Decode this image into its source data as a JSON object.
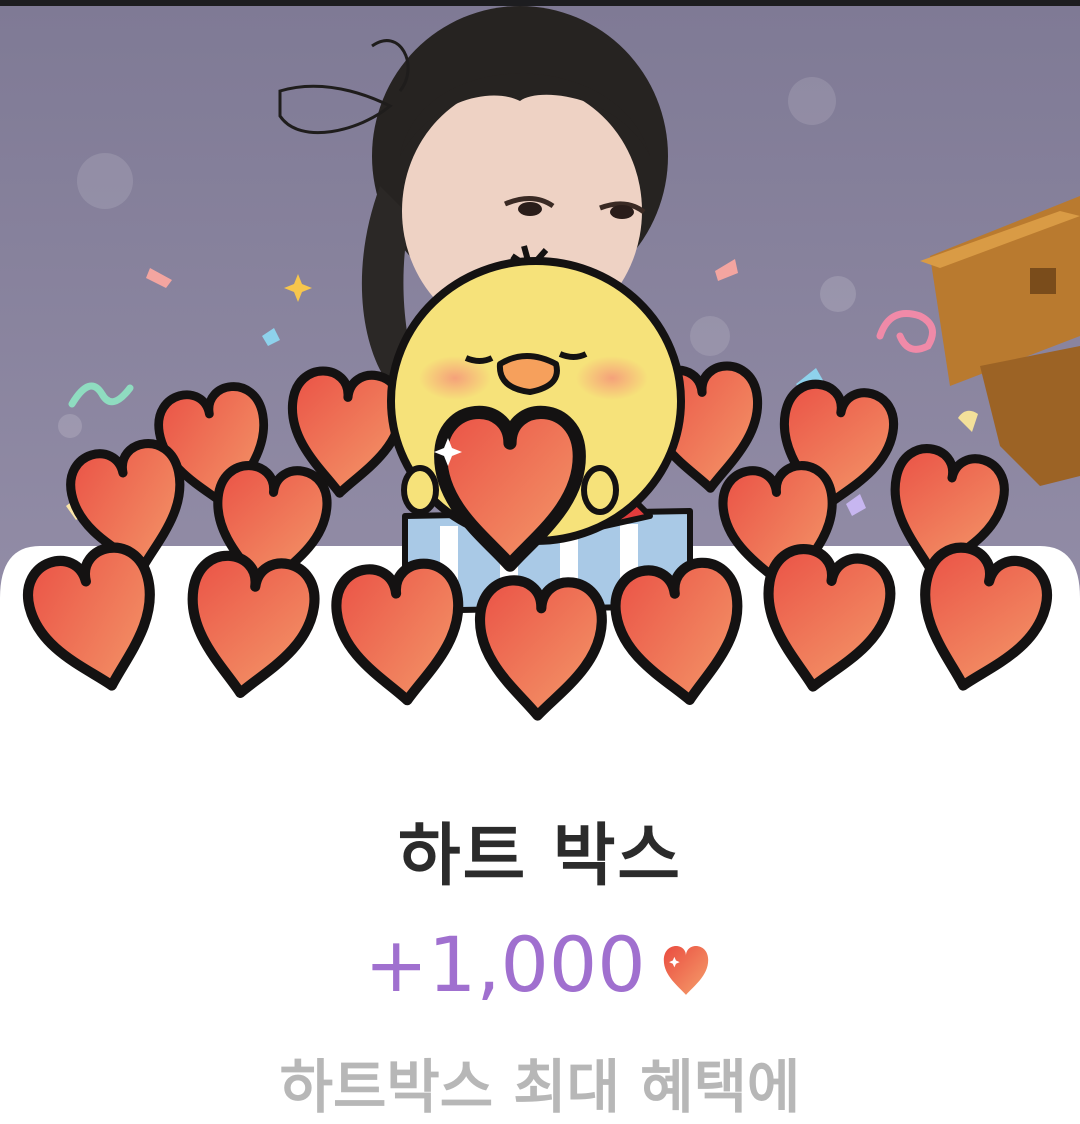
{
  "item": {
    "title": "하트 박스",
    "amount": "+1,000",
    "description": "하트박스 최대 혜택에"
  },
  "colors": {
    "amount": "#a070cf",
    "title": "#2b2b2b",
    "heart": "#ef6a50",
    "backdrop": "#85809e",
    "chick": "#f6e27a"
  },
  "icons": {
    "amount_suffix": "heart-icon",
    "mascot": "chick-mascot"
  }
}
